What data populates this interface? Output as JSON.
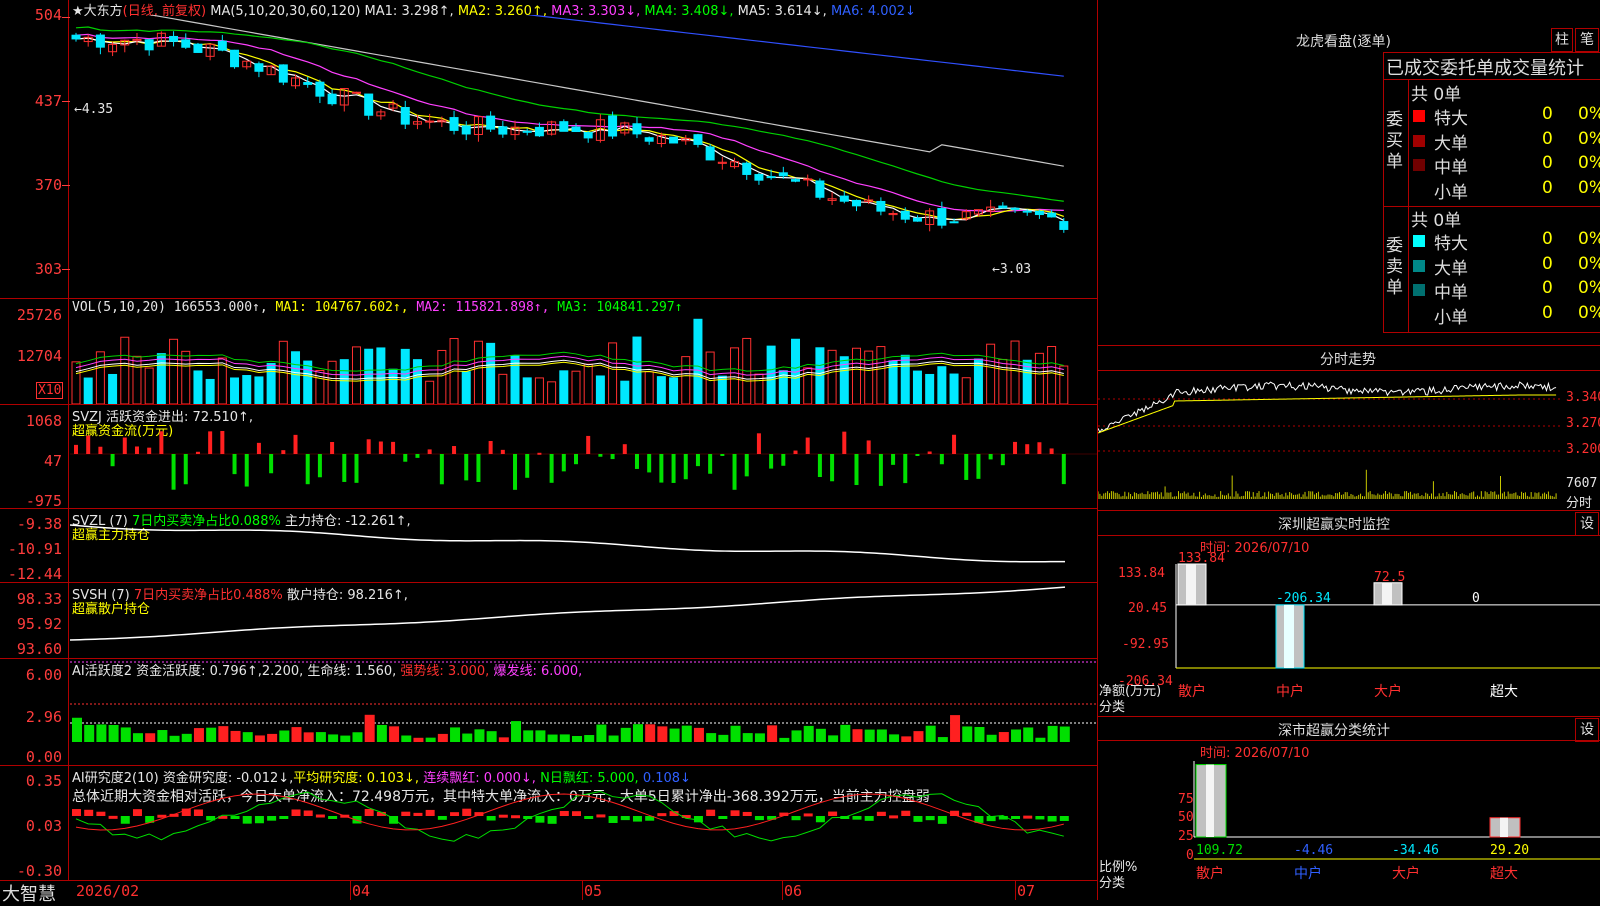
{
  "app": {
    "brand": "大智慧"
  },
  "main_header": {
    "star": "★",
    "stock_name": "大东方",
    "period": "(日线, 前复权)",
    "ma_label": "MA(5,10,20,30,60,120)",
    "ma1": "MA1: 3.298↑,",
    "ma2": "MA2: 3.260↑,",
    "ma3": "MA3: 3.303↓,",
    "ma4": "MA4: 3.408↓,",
    "ma5": "MA5: 3.614↓,",
    "ma6": "MA6: 4.002↓"
  },
  "price_axis": [
    "504",
    "437",
    "370",
    "303"
  ],
  "price_marks": {
    "high": "←4.35",
    "low": "←3.03"
  },
  "vol_header": {
    "name": "VOL(5,10,20)",
    "val": "166553.000↑,",
    "ma1": "MA1: 104767.602↑,",
    "ma2": "MA2: 115821.898↑,",
    "ma3": "MA3: 104841.297↑"
  },
  "vol_axis": [
    "25726",
    "12704"
  ],
  "vol_unit": "X10",
  "svzj_header": {
    "name": "SVZJ",
    "label": "活跃资金进出: 72.510↑,",
    "sub": "超赢资金流(万元)"
  },
  "svzj_axis": [
    "1068",
    "47",
    "-975"
  ],
  "svzl_header": {
    "name": "SVZL (7)",
    "label1": "7日内买卖净占比0.088%",
    "label2": "主力持仓: -12.261↑,",
    "sub": "超赢主力持仓"
  },
  "svzl_axis": [
    "-9.38",
    "-10.91",
    "-12.44"
  ],
  "svsh_header": {
    "name": "SVSH (7)",
    "label1": "7日内买卖净占比0.488%",
    "label2": "散户持仓: 98.216↑,",
    "sub": "超赢散户持仓"
  },
  "svsh_axis": [
    "98.33",
    "95.92",
    "93.60"
  ],
  "ai_active_header": {
    "name": "AI活跃度2",
    "label": "资金活跃度: 0.796↑,",
    "v2": "2.200,",
    "life": "生命线: 1.560,",
    "strong": "强势线: 3.000,",
    "burst": "爆发线: 6.000,"
  },
  "ai_active_axis": [
    "6.00",
    "2.96",
    "0.00"
  ],
  "ai_research_header": {
    "name": "AI研究度2(10)",
    "label": "资金研究度: -0.012↓,",
    "avg": "平均研究度: 0.103↓,",
    "lian": "连续飘红: 0.000↓,",
    "nday": "N日飘红: 5.000,",
    "last": "0.108↓"
  },
  "ai_research_note": "总体近期大资金相对活跃，今日大单净流入：72.498万元，其中特大单净流入：0万元，大单5日累计净出-368.392万元，当前主力控盘弱",
  "ai_research_axis": [
    "0.35",
    "0.03",
    "-0.30"
  ],
  "time_axis": [
    "2026/02",
    "04",
    "05",
    "06",
    "07"
  ],
  "right": {
    "dragon_title": "龙虎看盘(逐单)",
    "tab_bar": "柱",
    "tab_stroke": "笔",
    "subtitle": "已成交委托单成交量统计",
    "buy_side": "委买单",
    "sell_side": "委卖单",
    "buy_total": "共 0单",
    "sell_total": "共 0单",
    "buy_rows": [
      {
        "label": "特大",
        "count": "0",
        "pct": "0%",
        "color": "#ff0000"
      },
      {
        "label": "大单",
        "count": "0",
        "pct": "0%",
        "color": "#a00000"
      },
      {
        "label": "中单",
        "count": "0",
        "pct": "0%",
        "color": "#700000"
      },
      {
        "label": "小单",
        "count": "0",
        "pct": "0%",
        "color": "#000000"
      }
    ],
    "sell_rows": [
      {
        "label": "特大",
        "count": "0",
        "pct": "0%",
        "color": "#00ffff"
      },
      {
        "label": "大单",
        "count": "0",
        "pct": "0%",
        "color": "#008888"
      },
      {
        "label": "中单",
        "count": "0",
        "pct": "0%",
        "color": "#007070"
      },
      {
        "label": "小单",
        "count": "0",
        "pct": "0%",
        "color": "#000000"
      }
    ],
    "intraday_title": "分时走势",
    "intraday_axis": [
      "3.340",
      "3.270",
      "3.200"
    ],
    "intraday_vol": "7607",
    "intraday_vol_unit": "分时",
    "sz_monitor_title": "深圳超赢实时监控",
    "set_label": "设",
    "time_label": "时间: 2026/07/10",
    "monitor_axis": [
      "133.84",
      "20.45",
      "-92.95",
      "-206.34"
    ],
    "monitor_ylabel": "净额(万元)",
    "monitor_xlabel": "分类",
    "categories": [
      "散户",
      "中户",
      "大户",
      "超大"
    ],
    "monitor_values": [
      "133.84",
      "-206.34",
      "72.5",
      "0"
    ],
    "sz_stats_title": "深市超赢分类统计",
    "stats_axis": [
      "75",
      "50",
      "25",
      "0"
    ],
    "stats_ylabel": "比例%",
    "stats_xlabel": "分类",
    "stats_values": [
      "109.72",
      "-4.46",
      "-34.46",
      "29.20"
    ]
  }
}
